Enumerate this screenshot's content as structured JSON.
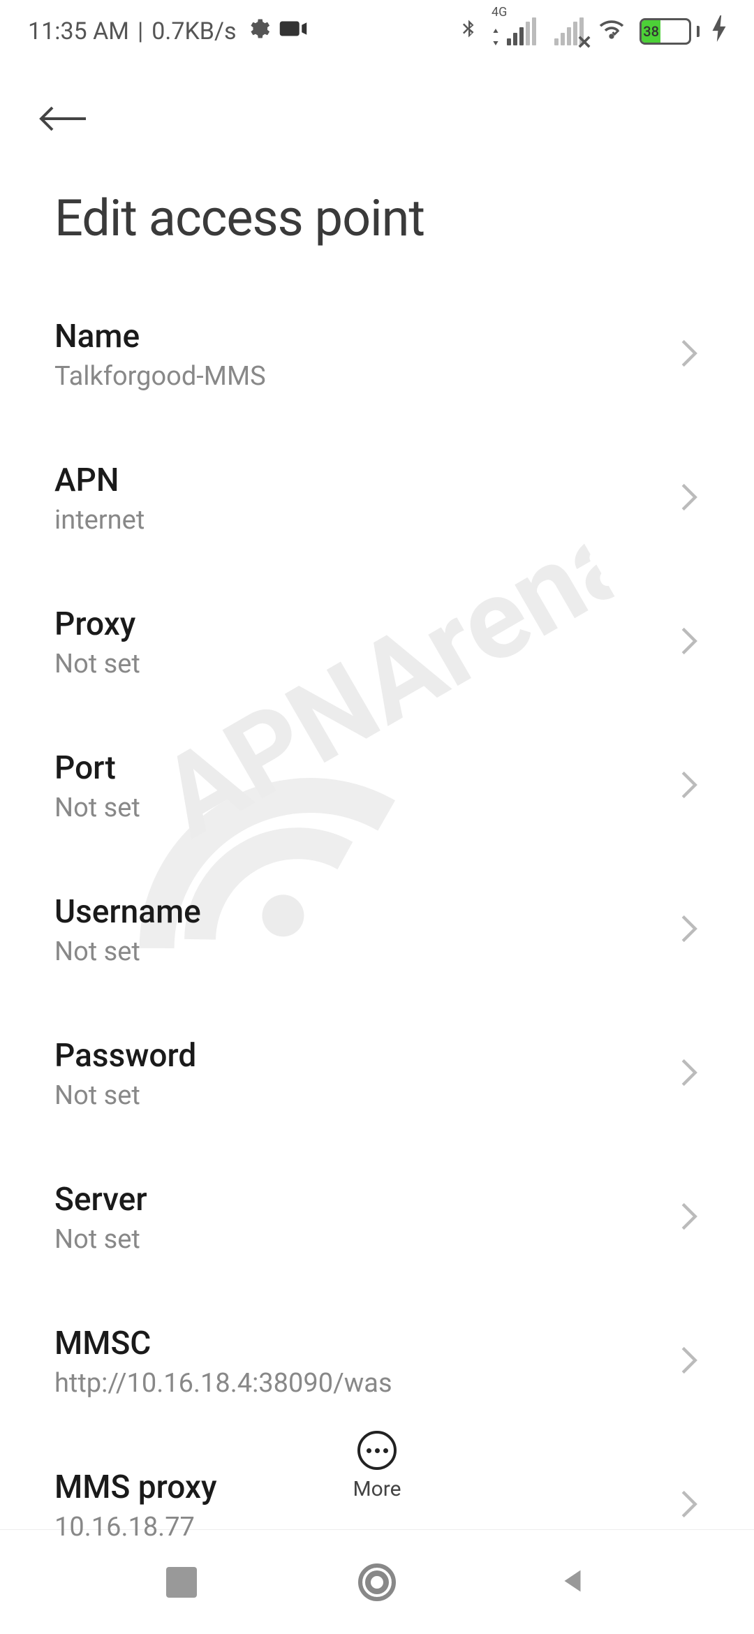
{
  "status": {
    "time": "11:35 AM",
    "speed": "0.7KB/s",
    "battery_pct": "38",
    "network_label": "4G"
  },
  "header": {
    "title": "Edit access point"
  },
  "items": [
    {
      "label": "Name",
      "value": "Talkforgood-MMS"
    },
    {
      "label": "APN",
      "value": "internet"
    },
    {
      "label": "Proxy",
      "value": "Not set"
    },
    {
      "label": "Port",
      "value": "Not set"
    },
    {
      "label": "Username",
      "value": "Not set"
    },
    {
      "label": "Password",
      "value": "Not set"
    },
    {
      "label": "Server",
      "value": "Not set"
    },
    {
      "label": "MMSC",
      "value": "http://10.16.18.4:38090/was"
    },
    {
      "label": "MMS proxy",
      "value": "10.16.18.77"
    }
  ],
  "footer": {
    "more_label": "More"
  },
  "watermark": "APNArena"
}
